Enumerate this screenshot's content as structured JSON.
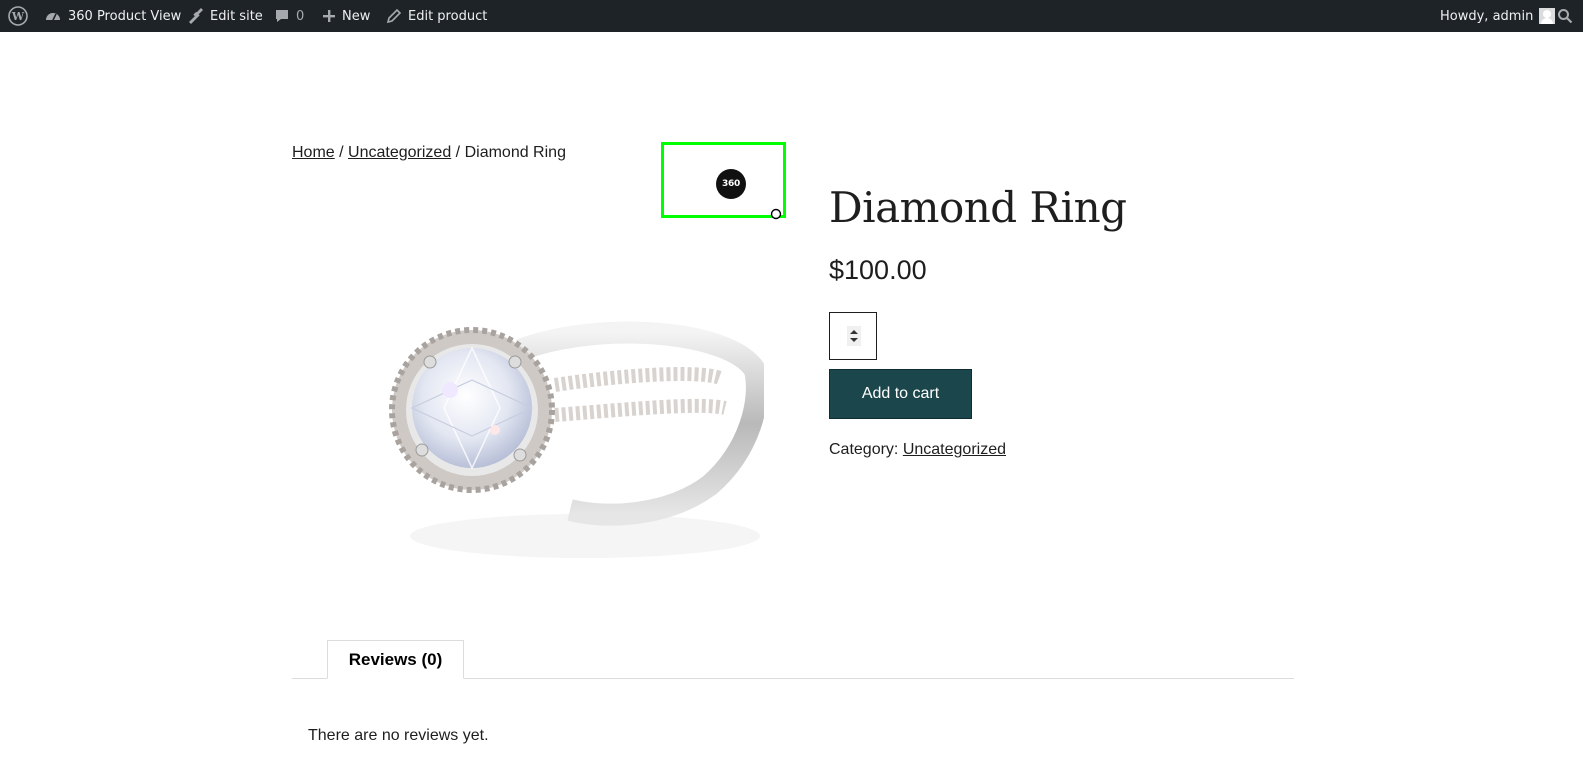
{
  "admin_bar": {
    "site_name": "360 Product View",
    "edit_site": "Edit site",
    "comments_count": "0",
    "new_label": "New",
    "edit_product": "Edit product",
    "greeting": "Howdy, admin",
    "bg_color": "#1d2327"
  },
  "breadcrumb": {
    "home": "Home",
    "separator": "/",
    "category": "Uncategorized",
    "current": "Diamond Ring"
  },
  "product": {
    "title": "Diamond Ring",
    "price": "$100.00",
    "quantity": "",
    "add_to_cart": "Add to cart",
    "category_label": "Category:",
    "category_value": "Uncategorized",
    "viewer_badge": "360",
    "button_color": "#1b464b",
    "highlight_color": "#00ff00"
  },
  "tabs": {
    "reviews_label": "Reviews (0)"
  },
  "reviews": {
    "empty_text": "There are no reviews yet."
  }
}
